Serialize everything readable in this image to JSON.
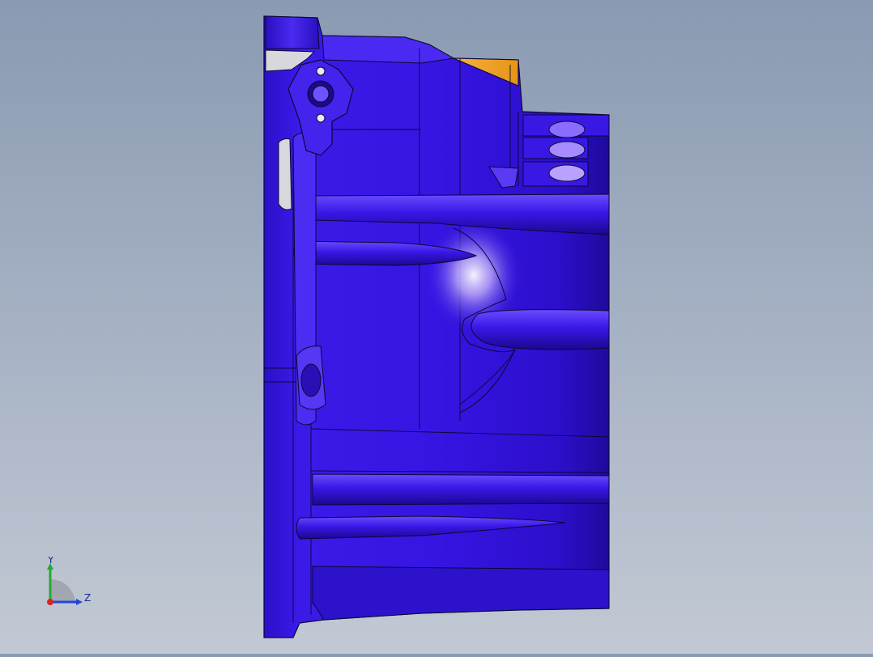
{
  "viewport": {
    "background_top": "#8a9ab2",
    "background_bottom": "#c2c9d4",
    "model_color": "#3a17e6",
    "model_shadow_color": "#1e0a8c",
    "highlight_color": "#f2eaff",
    "accent_face_color": "#f5a623",
    "edge_color": "#0a0838",
    "cut_face_color": "#d7d7dc"
  },
  "triad": {
    "y_label": "Y",
    "z_label": "Z",
    "y_color": "#22aa33",
    "z_color": "#2244dd",
    "x_color": "#dd2222"
  }
}
